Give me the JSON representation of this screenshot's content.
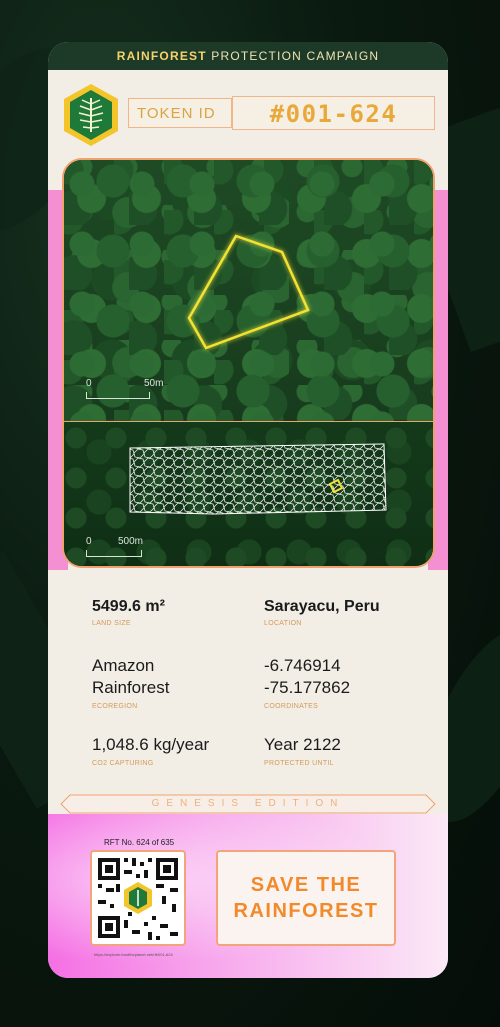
{
  "header": {
    "title_bold": "RAINFOREST",
    "title_rest": " PROTECTION CAMPAIGN"
  },
  "token": {
    "label": "TOKEN ID",
    "id": "#001-624"
  },
  "map": {
    "top_scale_start": "0",
    "top_scale_end": "50m",
    "bottom_scale_start": "0",
    "bottom_scale_end": "500m"
  },
  "details": {
    "land_size": {
      "value": "5499.6 m²",
      "label": "LAND SIZE"
    },
    "location": {
      "value": "Sarayacu, Peru",
      "label": "LOCATION"
    },
    "ecoregion": {
      "line1": "Amazon",
      "line2": "Rainforest",
      "label": "ECOREGION"
    },
    "coordinates": {
      "line1": "-6.746914",
      "line2": "-75.177862",
      "label": "COORDINATES"
    },
    "co2": {
      "value": "1,048.6 kg/year",
      "label": "CO2 CAPTURING"
    },
    "protected": {
      "value": "Year 2122",
      "label": "PROTECTED UNTIL"
    }
  },
  "edition": "GENESIS EDITION",
  "rft": "RFT No. 624 of 635",
  "qr_url": "https://explorer.fundtheplanet.net/rft/001-624",
  "cta": {
    "line1": "SAVE THE",
    "line2": "RAINFOREST"
  },
  "colors": {
    "accent": "#f08a2a",
    "header_bg": "#1d3a29",
    "polygon": "#f2e233",
    "pink": "#f56fe4"
  }
}
